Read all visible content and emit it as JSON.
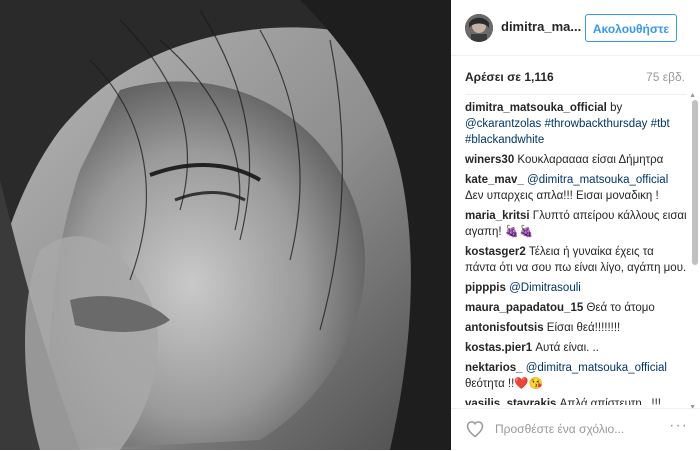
{
  "post": {
    "username": "dimitra_ma...",
    "follow_label": "Ακολουθήστε",
    "likes": "Αρέσει σε 1,116",
    "time": "75 εβδ."
  },
  "comments": [
    {
      "user": "dimitra_matsouka_official",
      "parts": [
        {
          "t": " by "
        },
        {
          "t": "@ckarantzolas",
          "m": true
        },
        {
          "t": " "
        },
        {
          "t": "#throwbackthursday",
          "m": true
        },
        {
          "t": " "
        },
        {
          "t": "#tbt",
          "m": true
        },
        {
          "t": " "
        },
        {
          "t": "#blackandwhite",
          "m": true
        }
      ]
    },
    {
      "user": "winers30",
      "parts": [
        {
          "t": " Κουκλαραααα είσαι Δήμητρα"
        }
      ]
    },
    {
      "user": "kate_mav_",
      "parts": [
        {
          "t": " "
        },
        {
          "t": "@dimitra_matsouka_official",
          "m": true
        },
        {
          "t": " Δεν υπαρχεις απλα!!! Εισαι μοναδικη !"
        }
      ]
    },
    {
      "user": "maria_kritsi",
      "parts": [
        {
          "t": " Γλυπτό απείρου κάλλους εισαι αγαπη! 🍇🍇"
        }
      ]
    },
    {
      "user": "kostasger2",
      "parts": [
        {
          "t": " Τέλεια ή γυναίκα έχεις τα πάντα ότι να σου πω είναι λίγο, αγάπη μου."
        }
      ]
    },
    {
      "user": "pipppis",
      "parts": [
        {
          "t": " "
        },
        {
          "t": "@Dimitrasouli",
          "m": true
        }
      ]
    },
    {
      "user": "maura_papadatou_15",
      "parts": [
        {
          "t": " Θεά το άτομο"
        }
      ]
    },
    {
      "user": "antonisfoutsis",
      "parts": [
        {
          "t": " Είσαι θεά!!!!!!!!"
        }
      ]
    },
    {
      "user": "kostas.pier1",
      "parts": [
        {
          "t": " Αυτά είναι. .."
        }
      ]
    },
    {
      "user": "nektarios_",
      "parts": [
        {
          "t": " "
        },
        {
          "t": "@dimitra_matsouka_official",
          "m": true
        },
        {
          "t": " θεότητα !!❤️😘"
        }
      ]
    },
    {
      "user": "vasilis_stavrakis",
      "parts": [
        {
          "t": " Απλά απίστευτη...!!!"
        }
      ]
    }
  ],
  "footer": {
    "placeholder": "Προσθέστε ένα σχόλιο...",
    "more_label": "···"
  },
  "colors": {
    "accent": "#3897f0",
    "mention": "#003569",
    "muted": "#999999"
  }
}
